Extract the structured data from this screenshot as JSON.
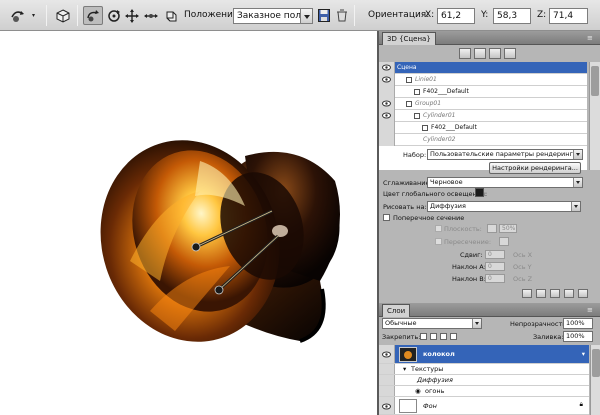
{
  "options_bar": {
    "position_label": "Положение:",
    "position_value": "Заказное пол...",
    "orientation_label": "Ориентация:",
    "x_label": "X:",
    "x_value": "61,2",
    "y_label": "Y:",
    "y_value": "58,3",
    "z_label": "Z:",
    "z_value": "71,4",
    "tools": [
      "rotate-3d-object-icon",
      "3d-cube-icon",
      "roll-3d-icon",
      "orbit-icon",
      "drag-3d-icon",
      "slide-3d-icon",
      "scale-3d-icon"
    ]
  },
  "panel_3d": {
    "tab_title": "3D {Сцена}",
    "filter_icons": [
      "scene-filter-icon",
      "mesh-filter-icon",
      "materials-filter-icon",
      "lights-filter-icon"
    ],
    "scene_items": [
      {
        "label": "Сцена",
        "selected": true
      },
      {
        "label": "Linie01",
        "selected": false
      },
      {
        "label": "F402___Default",
        "selected": false
      },
      {
        "label": "Group01",
        "selected": false
      },
      {
        "label": "Cylinder01",
        "selected": false
      },
      {
        "label": "F402___Default",
        "selected": false
      },
      {
        "label": "Cylinder02",
        "selected": false
      }
    ],
    "preset_label": "Набор:",
    "preset_value": "Пользовательские параметры рендеринга",
    "render_settings_button": "Настройки рендеринга...",
    "antialias_label": "Сглаживание:",
    "antialias_value": "Черновое",
    "global_ambient_label": "Цвет глобального освещения:",
    "global_ambient_color": "#1a1a1a",
    "paint_on_label": "Рисовать на:",
    "paint_on_value": "Диффузия",
    "cross_section_label": "Поперечное сечение",
    "opacity_label": "Плоскость:",
    "opacity_value": "50%",
    "intersection_label": "Пересечение:",
    "offset_label": "Сдвиг:",
    "offset_value": "0",
    "tilt_a_label": "Наклон А:",
    "tilt_a_value": "0",
    "tilt_b_label": "Наклон В:",
    "tilt_b_value": "0",
    "axis_x": "Ось X",
    "axis_y": "Ось Y",
    "axis_z": "Ось Z"
  },
  "layers_panel": {
    "tab_title": "Слои",
    "blend_mode": "Обычные",
    "opacity_label": "Непрозрачность:",
    "opacity_value": "100%",
    "lock_label": "Закрепить:",
    "fill_label": "Заливка:",
    "fill_value": "100%",
    "layers": [
      {
        "label": "колокол",
        "selected": true
      },
      {
        "label": "Текстуры",
        "selected": false
      },
      {
        "label": "Диффузия",
        "selected": false
      },
      {
        "label": "огонь",
        "selected": false
      },
      {
        "label": "Фон",
        "selected": false
      }
    ]
  },
  "colors": {
    "selection_blue": "#3464b8",
    "panel_gray": "#b6b6b6",
    "toolbar_gray": "#d8d8d8"
  }
}
